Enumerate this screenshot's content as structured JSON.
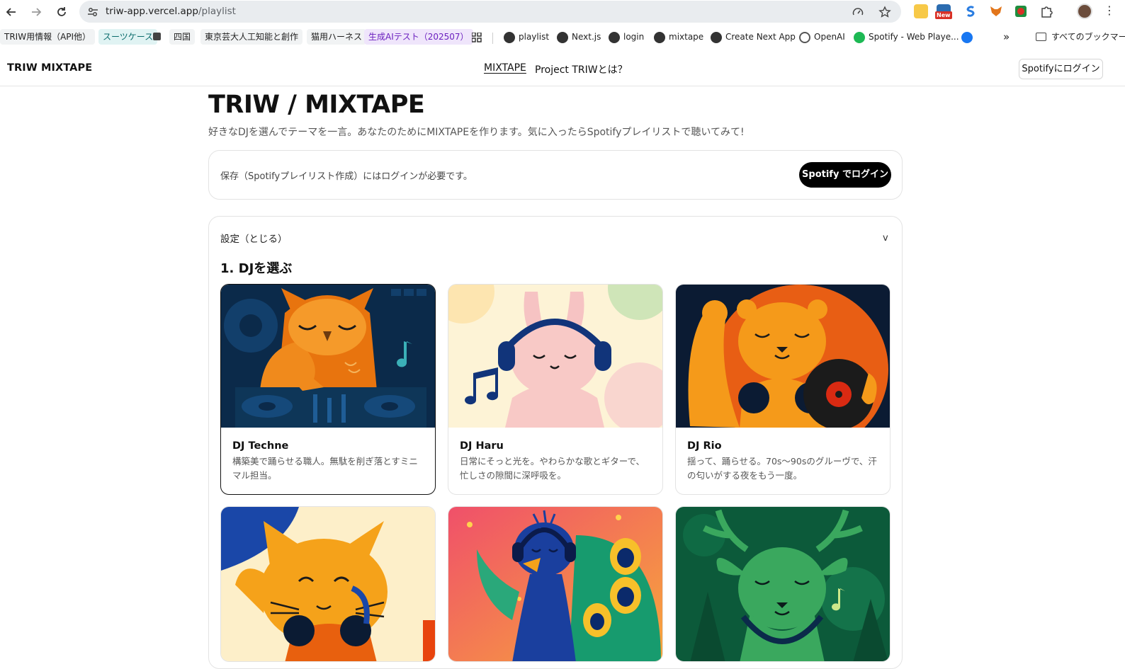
{
  "browser": {
    "url_host": "triw-app.vercel.app",
    "url_path": "/playlist",
    "extension_badge": "New",
    "bookmarks": {
      "b1": "TRIW用情報（API他）",
      "b2": "スーツケース",
      "b3": "四国",
      "b4": "東京芸大人工知能と創作",
      "b5": "猫用ハーネス",
      "b6": "生成AIテスト（202507）",
      "b7": "playlist",
      "b8": "Next.js",
      "b9": "login",
      "b10": "mixtape",
      "b11": "Create Next App",
      "b12": "OpenAI",
      "b13": "Spotify - Web Playe...",
      "more": "»",
      "all": "すべてのブックマーク"
    }
  },
  "header": {
    "brand": "TRIW MIXTAPE",
    "nav_mixtape": "MIXTAPE",
    "nav_about": "Project TRIWとは？",
    "login": "Spotifyにログイン"
  },
  "page": {
    "title": "TRIW / MIXTAPE",
    "subtitle": "好きなDJを選んでテーマを一言。あなたのためにMIXTAPEを作ります。気に入ったらSpotifyプレイリストで聴いてみて!"
  },
  "notice": {
    "text": "保存（Spotifyプレイリスト作成）にはログインが必要です。",
    "button": "Spotify でログイン"
  },
  "settings": {
    "label": "設定（とじる）",
    "chevron": "v",
    "section_title": "1. DJを選ぶ"
  },
  "djs": [
    {
      "name": "DJ Techne",
      "desc": "構築美で踊らせる職人。無駄を削ぎ落とすミニマル担当。"
    },
    {
      "name": "DJ Haru",
      "desc": "日常にそっと光を。やわらかな歌とギターで、忙しさの隙間に深呼吸を。"
    },
    {
      "name": "DJ Rio",
      "desc": "揺って、踊らせる。70s〜90sのグルーヴで、汗の匂いがする夜をもう一度。"
    }
  ],
  "colors": {
    "accent": "#000000",
    "spotify_green": "#1db954"
  }
}
